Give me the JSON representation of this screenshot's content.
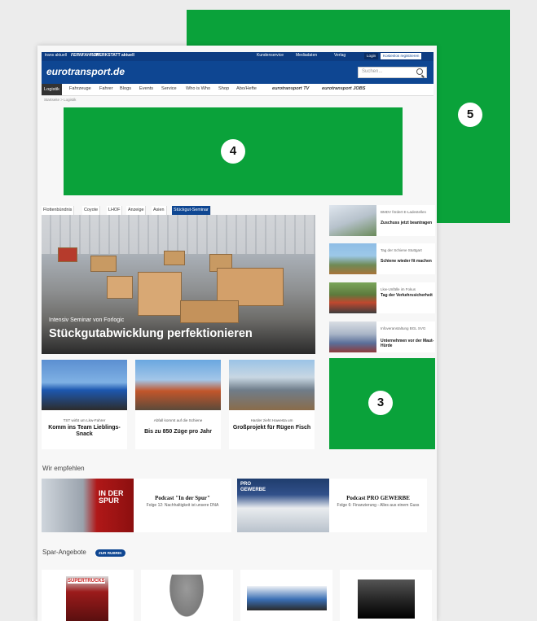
{
  "ads": {
    "ad3_label": "3",
    "ad4_label": "4",
    "ad5_label": "5",
    "ad_color": "#0aa23a"
  },
  "topbar": {
    "links": [
      "trans aktuell",
      "FERNFAHRER",
      "WERKSTATT aktuell"
    ],
    "service_links": [
      "Kundenservice",
      "Mediadaten",
      "Verlag"
    ],
    "login": "Login",
    "register": "Kostenlos registrieren"
  },
  "brand": {
    "logo": "eurotransport.de",
    "search_placeholder": "Suchen..."
  },
  "nav": {
    "items": [
      "Logistik",
      "Fahrzeuge",
      "Fahrer",
      "Blogs",
      "Events",
      "Service",
      "Who is Who",
      "Shop",
      "Abo/Hefte",
      "eurotransport TV",
      "eurotransport JOBS"
    ]
  },
  "breadcrumb": "Startseite  >  Logistik",
  "hero": {
    "tabs": [
      "Flottenbündnis",
      "Coyote",
      "LHOF",
      "Anzeige",
      "Asien",
      "Stückgut-Seminar"
    ],
    "kicker": "Intensiv Seminar von Forlogic",
    "title": "Stückgutabwicklung perfektionieren"
  },
  "side": [
    {
      "kicker": "BMDV fördert E-Ladestellen",
      "title": "Zuschuss jetzt beantragen"
    },
    {
      "kicker": "Tag der Schiene Stuttgart",
      "title": "Schiene wieder fit machen"
    },
    {
      "kicker": "Lkw-Unfälle im Fokus",
      "title": "Tag der Verkehrssicherheit"
    },
    {
      "kicker": "Infoveranstaltung BGL SVG",
      "title": "Unternehmen vor der Maut-Hürde"
    }
  ],
  "cards": [
    {
      "kicker": "TST wirbt um Lkw-Fahrer",
      "title": "Komm ins Team Lieblings-Snack"
    },
    {
      "kicker": "Abfall kommt auf die Schiene",
      "title": "Bis zu 850 Züge pro Jahr"
    },
    {
      "kicker": "Harder zieht Hawesta um",
      "title": "Großprojekt für Rügen Fisch"
    }
  ],
  "recommend": {
    "heading": "Wir empfehlen",
    "items": [
      {
        "title": "Podcast \"In der Spur\"",
        "sub": "Folge 12: Nachhaltigkeit ist unsere DNA",
        "img_text": "IN DER SPUR"
      },
      {
        "title": "Podcast PRO GEWERBE",
        "sub": "Folge 6: Finanzierung - Alles aus einem Guss",
        "img_text": "PRO GEWERBE"
      }
    ]
  },
  "offers": {
    "heading": "Spar-Angebote",
    "rubrik": "ZUR RUBRIK",
    "book_text": "SUPERTRUCKS"
  }
}
